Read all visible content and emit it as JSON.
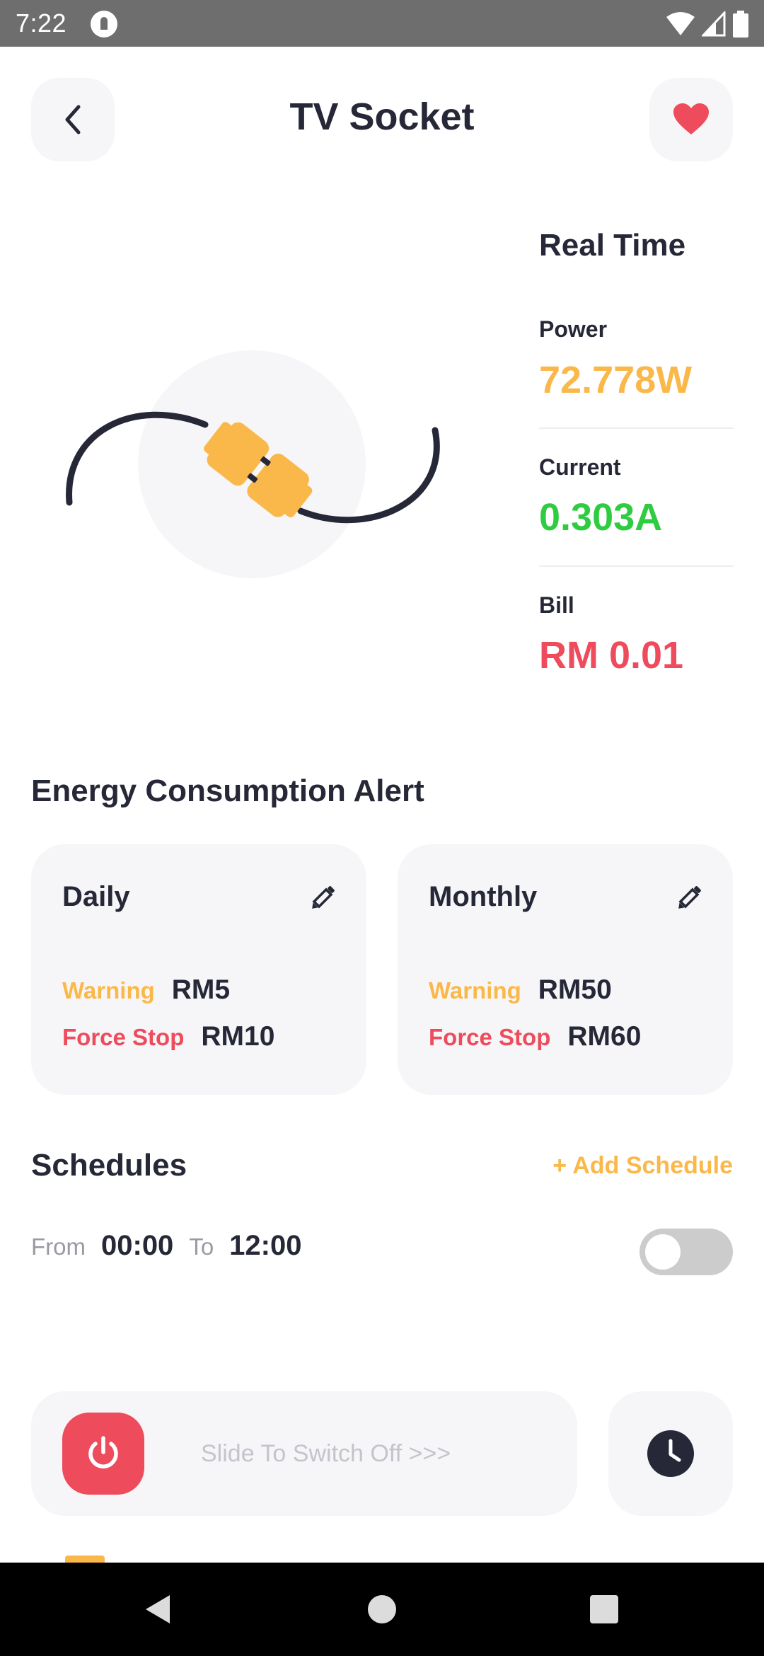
{
  "status_bar": {
    "time": "7:22"
  },
  "header": {
    "title": "TV Socket"
  },
  "realtime": {
    "title": "Real Time",
    "power_label": "Power",
    "power_value": "72.778W",
    "current_label": "Current",
    "current_value": "0.303A",
    "bill_label": "Bill",
    "bill_value": "RM 0.01"
  },
  "energy_alert": {
    "title": "Energy Consumption Alert",
    "cards": [
      {
        "title": "Daily",
        "warning_label": "Warning",
        "warning_value": "RM5",
        "force_label": "Force Stop",
        "force_value": "RM10"
      },
      {
        "title": "Monthly",
        "warning_label": "Warning",
        "warning_value": "RM50",
        "force_label": "Force Stop",
        "force_value": "RM60"
      }
    ]
  },
  "schedules": {
    "title": "Schedules",
    "add_label": "+ Add Schedule",
    "items": [
      {
        "from_label": "From",
        "from_value": "00:00",
        "to_label": "To",
        "to_value": "12:00",
        "enabled": false
      }
    ]
  },
  "controls": {
    "slide_text": "Slide To Switch Off >>>"
  },
  "colors": {
    "accent_orange": "#fbb84a",
    "accent_green": "#2ecc40",
    "accent_red": "#ee4b5c",
    "dark_text": "#262837",
    "card_bg": "#f6f6f8"
  },
  "icons": {
    "back": "chevron-left-icon",
    "favorite": "heart-icon",
    "edit": "pencil-icon",
    "power": "power-icon",
    "schedule": "clock-icon"
  }
}
